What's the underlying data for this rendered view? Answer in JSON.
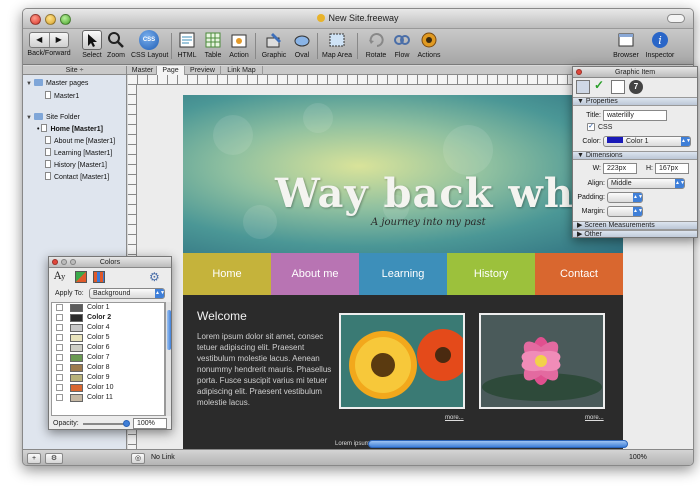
{
  "window": {
    "title": "New Site.freeway"
  },
  "toolbar": {
    "back_forward": "Back/Forward",
    "select": "Select",
    "zoom": "Zoom",
    "css_layout": "CSS Layout",
    "css_badge": "CSS",
    "html": "HTML",
    "table": "Table",
    "action": "Action",
    "graphic": "Graphic",
    "oval": "Oval",
    "map_area": "Map Area",
    "rotate": "Rotate",
    "flow": "Flow",
    "actions": "Actions",
    "browser": "Browser",
    "inspector": "Inspector"
  },
  "tabs": {
    "site_header": "Site ÷",
    "items": [
      "Master",
      "Page",
      "Preview",
      "Link Map"
    ],
    "active": "Page"
  },
  "sidebar": {
    "master_pages": "Master pages",
    "master1": "Master1",
    "site_folder": "Site Folder",
    "pages": [
      "Home [Master1]",
      "About me [Master1]",
      "Learning [Master1]",
      "History [Master1]",
      "Contact [Master1]"
    ]
  },
  "site": {
    "title": "Way back whe",
    "subtitle": "A journey into my past",
    "nav": [
      {
        "label": "Home",
        "color": "#c5b33b"
      },
      {
        "label": "About me",
        "color": "#b874b3"
      },
      {
        "label": "Learning",
        "color": "#3d8fba"
      },
      {
        "label": "History",
        "color": "#9cc13c"
      },
      {
        "label": "Contact",
        "color": "#d9672f"
      }
    ],
    "welcome": "Welcome",
    "body": "Lorem ipsum dolor sit amet, consec tetuer adipiscing elit. Praesent vestibulum molestie lacus. Aenean nonummy hendrerit mauris. Phasellus porta. Fusce suscipit varius mi tetuer adipiscing elit. Praesent vestibulum molestie lacus.",
    "more1": "more...",
    "more2": "more...",
    "footer": "Lorem ipsum dolor sit amet, consec tetuer adipiscing elit. Praesent vestibulum"
  },
  "status": {
    "link": "No Link",
    "zoom": "100%"
  },
  "colors_panel": {
    "title": "Colors",
    "apply_to_label": "Apply To:",
    "apply_to_value": "Background",
    "opacity_label": "Opacity:",
    "opacity_value": "100%",
    "swatches": [
      {
        "name": "Color 1",
        "hex": "#5c5c5c",
        "bold": false
      },
      {
        "name": "Color 2",
        "hex": "#2b2b2b",
        "bold": true
      },
      {
        "name": "Color 4",
        "hex": "#c8c8c8",
        "bold": false
      },
      {
        "name": "Color 5",
        "hex": "#e9e4bd",
        "bold": false
      },
      {
        "name": "Color 6",
        "hex": "#cfcfc6",
        "bold": false
      },
      {
        "name": "Color 7",
        "hex": "#6a9a52",
        "bold": false
      },
      {
        "name": "Color 8",
        "hex": "#9c7a4e",
        "bold": false
      },
      {
        "name": "Color 9",
        "hex": "#b8b27a",
        "bold": false
      },
      {
        "name": "Color 10",
        "hex": "#d9672f",
        "bold": false
      },
      {
        "name": "Color 11",
        "hex": "#c6b8a4",
        "bold": false
      }
    ]
  },
  "graphic_panel": {
    "title": "Graphic Item",
    "properties": "Properties",
    "title_label": "Title:",
    "title_value": "waterlilly",
    "css_label": "CSS",
    "color_label": "Color:",
    "color_value": "Color 1",
    "dimensions": "Dimensions",
    "w_label": "W:",
    "w_value": "223px",
    "h_label": "H:",
    "h_value": "167px",
    "align_label": "Align:",
    "align_value": "Middle",
    "padding_label": "Padding:",
    "margin_label": "Margin:",
    "screen_measurements": "Screen Measurements",
    "other": "Other",
    "icon_badge": "7"
  }
}
